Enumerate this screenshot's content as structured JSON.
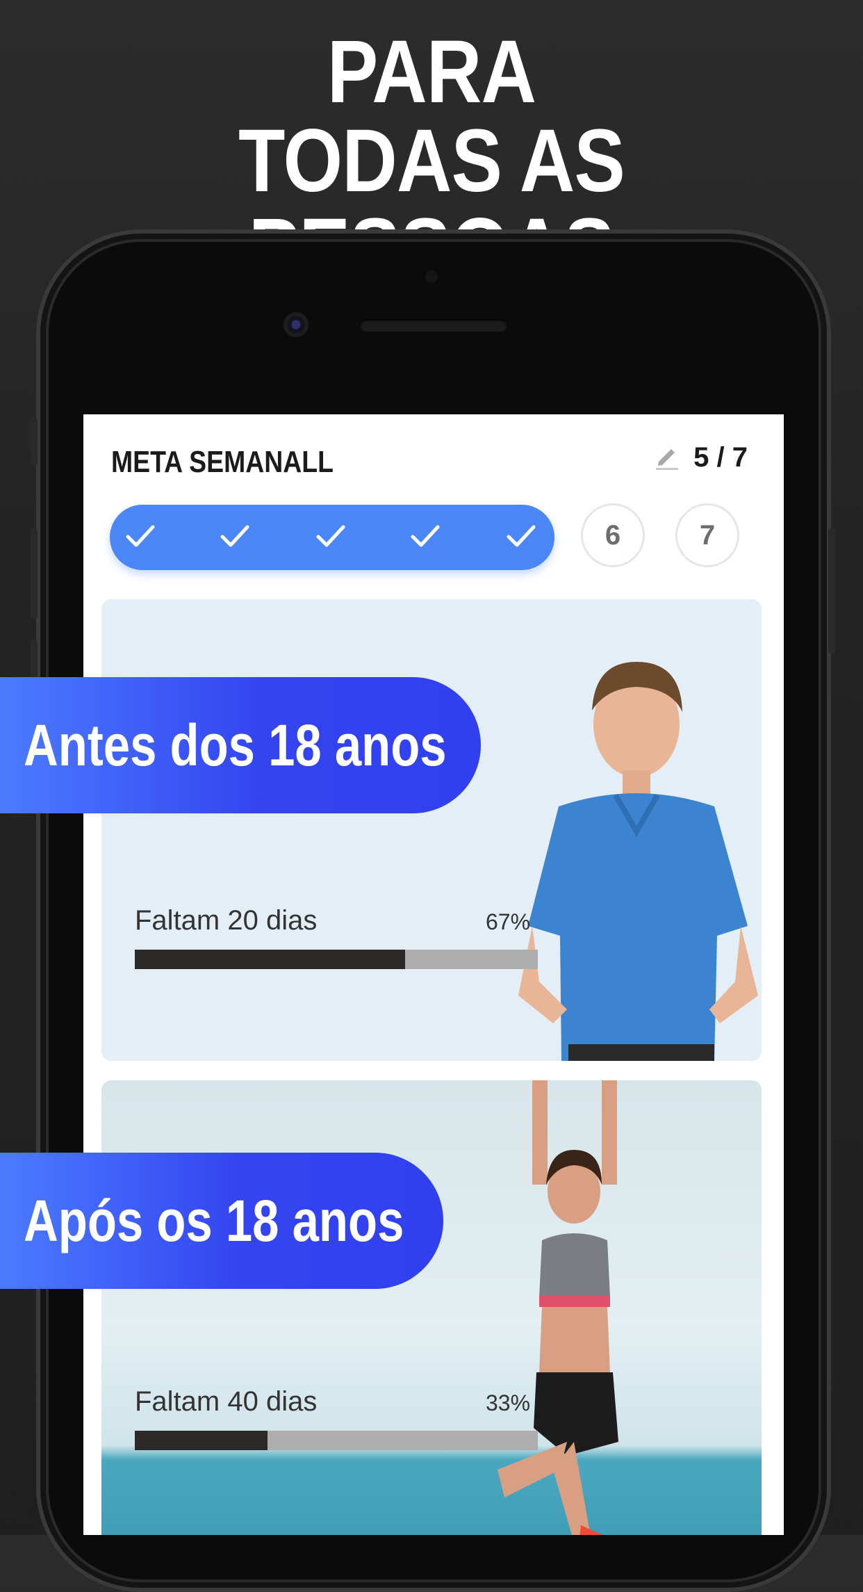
{
  "headline": {
    "line1": "PARA",
    "line2": "TODAS AS PESSOAS"
  },
  "weekly_goal": {
    "title": "META SEMANALL",
    "count": "5 / 7",
    "edit_icon": "pencil-icon",
    "completed_days": 5,
    "remaining_days": [
      "6",
      "7"
    ]
  },
  "cards": [
    {
      "label": "Faltam 20 dias",
      "percent_text": "67%",
      "progress": 0.67
    },
    {
      "label": "Faltam 40 dias",
      "percent_text": "33%",
      "progress": 0.33
    }
  ],
  "badges": [
    {
      "text": "Antes dos 18 anos"
    },
    {
      "text": "Após os 18 anos"
    }
  ],
  "colors": {
    "accent_blue": "#4a86f6",
    "badge_gradient_start": "#4c7bff",
    "badge_gradient_end": "#3140ef",
    "progress_fill": "#2c2a29",
    "progress_track": "#aeaeae"
  }
}
